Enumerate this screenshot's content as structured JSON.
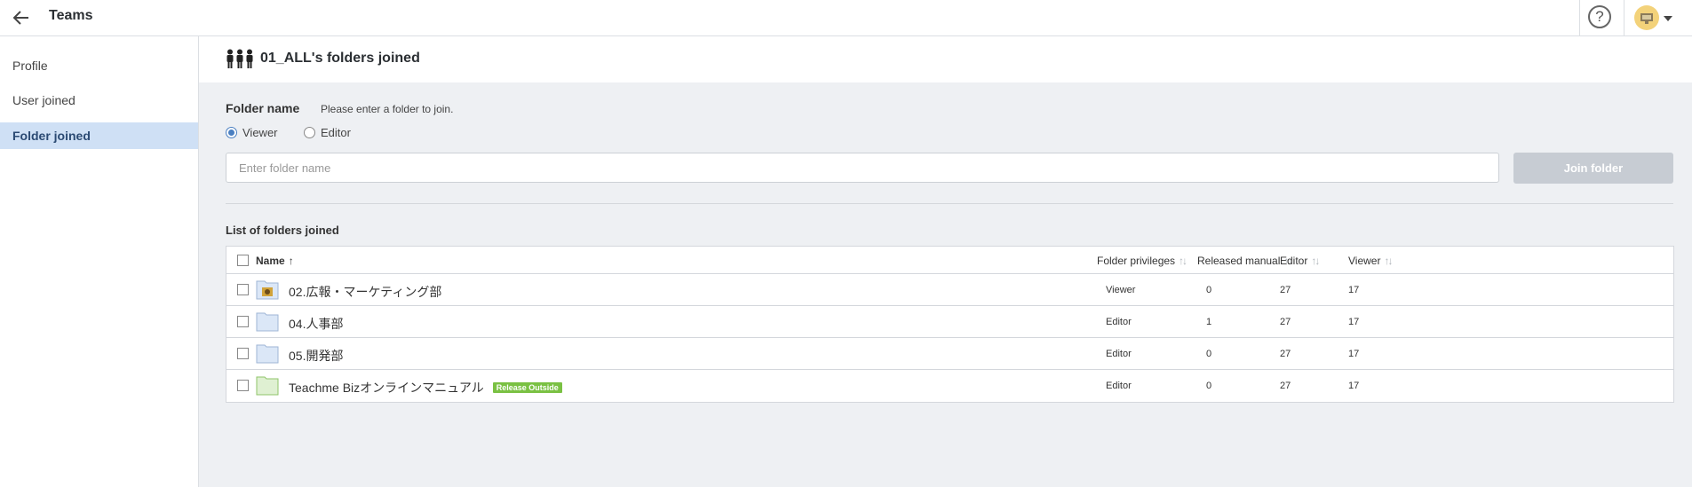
{
  "header": {
    "title": "Teams"
  },
  "sidebar": {
    "items": [
      {
        "label": "Profile"
      },
      {
        "label": "User joined"
      },
      {
        "label": "Folder joined"
      }
    ]
  },
  "page": {
    "title": "01_ALL's folders joined"
  },
  "form": {
    "folder_name_label": "Folder name",
    "hint": "Please enter a folder to join.",
    "radio_viewer": "Viewer",
    "radio_editor": "Editor",
    "selected_role": "Viewer",
    "input_placeholder": "Enter folder name",
    "input_value": "",
    "join_button": "Join folder"
  },
  "list": {
    "title": "List of folders joined",
    "columns": {
      "name": "Name",
      "privileges": "Folder privileges",
      "released": "Released manual",
      "editor": "Editor",
      "viewer": "Viewer"
    },
    "rows": [
      {
        "name": "02.広報・マーケティング部",
        "privileges": "Viewer",
        "released": "0",
        "editor": "27",
        "viewer": "17",
        "icon": "folder-with-image-icon",
        "badge": ""
      },
      {
        "name": "04.人事部",
        "privileges": "Editor",
        "released": "1",
        "editor": "27",
        "viewer": "17",
        "icon": "folder-icon",
        "badge": ""
      },
      {
        "name": "05.開発部",
        "privileges": "Editor",
        "released": "0",
        "editor": "27",
        "viewer": "17",
        "icon": "folder-icon",
        "badge": ""
      },
      {
        "name": "Teachme Bizオンラインマニュアル",
        "privileges": "Editor",
        "released": "0",
        "editor": "27",
        "viewer": "17",
        "icon": "green-folder-icon",
        "badge": "Release Outside"
      }
    ]
  },
  "colors": {
    "accent": "#4a7fc1",
    "sidebar_active_bg": "#cfe0f5",
    "main_bg": "#eef0f3",
    "join_button_disabled": "#c7ccd3",
    "badge_green": "#7ac143"
  }
}
